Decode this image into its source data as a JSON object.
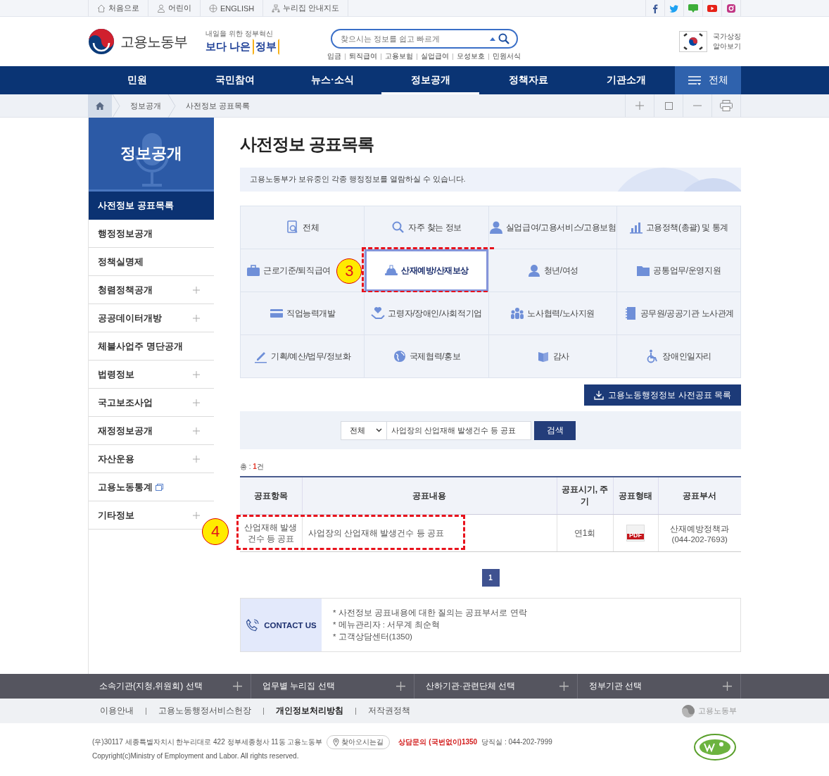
{
  "utility_links": [
    {
      "label": "처음으로"
    },
    {
      "label": "어린이"
    },
    {
      "label": "ENGLISH"
    },
    {
      "label": "누리집 안내지도"
    }
  ],
  "header": {
    "ministry_name": "고용노동부",
    "slogan_small": "내일을 위한 정부혁신",
    "slogan_lead": "보다 나은",
    "slogan_key": "정부",
    "search": {
      "placeholder": "찾으시는 정보를 쉽고 빠르게"
    },
    "quick_links": [
      "임금",
      "퇴직급여",
      "고용보험",
      "실업급여",
      "모성보호",
      "민원서식"
    ],
    "national_symbols": [
      "국가상징",
      "알아보기"
    ]
  },
  "nav": {
    "items": [
      {
        "label": "민원",
        "selected": false
      },
      {
        "label": "국민참여",
        "selected": false
      },
      {
        "label": "뉴스·소식",
        "selected": false
      },
      {
        "label": "정보공개",
        "selected": true
      },
      {
        "label": "정책자료",
        "selected": false
      },
      {
        "label": "기관소개",
        "selected": false
      }
    ],
    "all_menu": "전체"
  },
  "breadcrumb": [
    "정보공개",
    "사전정보 공표목록"
  ],
  "sidebar": {
    "title": "정보공개",
    "items": [
      {
        "label": "사전정보 공표목록",
        "selected": true,
        "expandable": false
      },
      {
        "label": "행정정보공개",
        "selected": false,
        "expandable": false
      },
      {
        "label": "정책실명제",
        "selected": false,
        "expandable": false
      },
      {
        "label": "청렴정책공개",
        "selected": false,
        "expandable": true
      },
      {
        "label": "공공데이터개방",
        "selected": false,
        "expandable": true
      },
      {
        "label": "체불사업주 명단공개",
        "selected": false,
        "expandable": false
      },
      {
        "label": "법령정보",
        "selected": false,
        "expandable": true
      },
      {
        "label": "국고보조사업",
        "selected": false,
        "expandable": true
      },
      {
        "label": "재정정보공개",
        "selected": false,
        "expandable": true
      },
      {
        "label": "자산운용",
        "selected": false,
        "expandable": true
      },
      {
        "label": "고용노동통계",
        "selected": false,
        "expandable": false,
        "external": true
      },
      {
        "label": "기타정보",
        "selected": false,
        "expandable": true
      }
    ]
  },
  "page_title": "사전정보 공표목록",
  "intro": "고용노동부가 보유중인 각종 행정정보를 열람하실 수 있습니다.",
  "categories": [
    {
      "label": "전체",
      "selected": false
    },
    {
      "label": "자주 찾는 정보",
      "selected": false
    },
    {
      "label": "실업급여/고용서비스/고용보험",
      "selected": false
    },
    {
      "label": "고용정책(총괄) 및 통계",
      "selected": false
    },
    {
      "label": "근로기준/퇴직급여",
      "selected": false
    },
    {
      "label": "산재예방/산재보상",
      "selected": true,
      "marker": "3"
    },
    {
      "label": "청년/여성",
      "selected": false
    },
    {
      "label": "공통업무/운영지원",
      "selected": false
    },
    {
      "label": "직업능력개발",
      "selected": false
    },
    {
      "label": "고령자/장애인/사회적기업",
      "selected": false
    },
    {
      "label": "노사협력/노사지원",
      "selected": false
    },
    {
      "label": "공무원/공공기관 노사관계",
      "selected": false
    },
    {
      "label": "기획/예산/법무/정보화",
      "selected": false
    },
    {
      "label": "국제협력/홍보",
      "selected": false
    },
    {
      "label": "감사",
      "selected": false
    },
    {
      "label": "장애인일자리",
      "selected": false
    }
  ],
  "download_button": "고용노동행정정보 사전공표 목록",
  "search": {
    "scope": "전체",
    "value": "사업장의 산업재해 발생건수 등 공표",
    "button": "검색"
  },
  "total": {
    "prefix": "총 : ",
    "value": "1",
    "suffix": "건"
  },
  "table": {
    "columns": [
      "공표항목",
      "공표내용",
      "공표시기, 주기",
      "공표형태",
      "공표부서"
    ],
    "rows": [
      {
        "item": "산업재해 발생 건수 등 공표",
        "content": "사업장의 산업재해 발생건수 등 공표",
        "period": "연1회",
        "format": "PDF",
        "department": "산재예방정책과",
        "phone": "(044-202-7693)",
        "marker": "4"
      }
    ]
  },
  "pagination": [
    {
      "label": "1",
      "selected": true
    }
  ],
  "contact": {
    "title": "CONTACT US",
    "lines": [
      "* 사전정보 공표내용에 대한 질의는 공표부서로 연락",
      "* 메뉴관리자 : 서무계 최순혁",
      "* 고객상담센터(1350)"
    ]
  },
  "footer_selectors": [
    "소속기관(지청,위원회) 선택",
    "업무별 누리집 선택",
    "산하기관·관련단체 선택",
    "정부기관 선택"
  ],
  "footer_links": [
    {
      "label": "이용안내",
      "emphasized": false
    },
    {
      "label": "고용노동행정서비스헌장",
      "emphasized": false
    },
    {
      "label": "개인정보처리방침",
      "emphasized": true
    },
    {
      "label": "저작권정책",
      "emphasized": false
    }
  ],
  "footer_logo": "고용노동부",
  "footer": {
    "address": "(우)30117 세종특별자치시 한누리대로 422 정부세종청사 11동 고용노동부",
    "directions": "찾아오시는길",
    "hotline": "상담문의 (국번없이)1350",
    "duty": "당직실 : 044-202-7999",
    "copyright": "Copyright(c)Ministry of Employment and Labor. All rights reserved."
  }
}
